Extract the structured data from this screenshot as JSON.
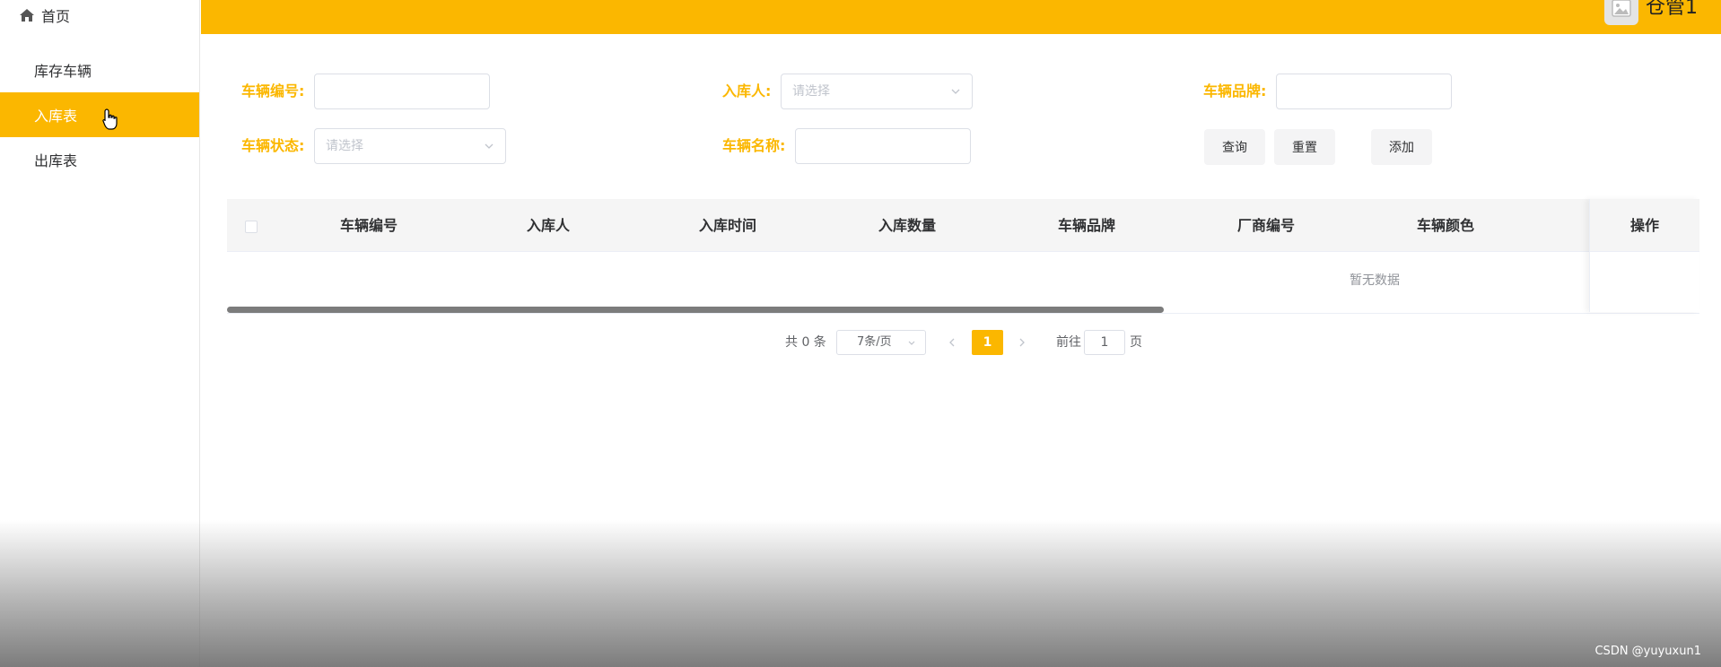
{
  "sidebar": {
    "home_label": "首页",
    "items": [
      {
        "label": "库存车辆",
        "active": false
      },
      {
        "label": "入库表",
        "active": true
      },
      {
        "label": "出库表",
        "active": false
      }
    ]
  },
  "header": {
    "user_name": "仓管1",
    "avatar_icon": "image-icon"
  },
  "search": {
    "vehicle_no_label": "车辆编号:",
    "vehicle_no_value": "",
    "inbound_person_label": "入库人:",
    "inbound_person_placeholder": "请选择",
    "brand_label": "车辆品牌:",
    "brand_value": "",
    "status_label": "车辆状态:",
    "status_placeholder": "请选择",
    "vehicle_name_label": "车辆名称:",
    "vehicle_name_value": "",
    "query_button": "查询",
    "reset_button": "重置",
    "add_button": "添加"
  },
  "table": {
    "columns": [
      "车辆编号",
      "入库人",
      "入库时间",
      "入库数量",
      "车辆品牌",
      "厂商编号",
      "车辆颜色"
    ],
    "action_column": "操作",
    "empty_text": "暂无数据",
    "rows": []
  },
  "pagination": {
    "total_text": "共 0 条",
    "page_size": "7条/页",
    "current_page": "1",
    "goto_label": "前往",
    "goto_value": "1",
    "page_suffix": "页"
  },
  "watermark": "CSDN @yuyuxun1",
  "colors": {
    "accent": "#fbb700",
    "sidebar_active_text": "#ffffff",
    "header_bg": "#fbb700"
  }
}
